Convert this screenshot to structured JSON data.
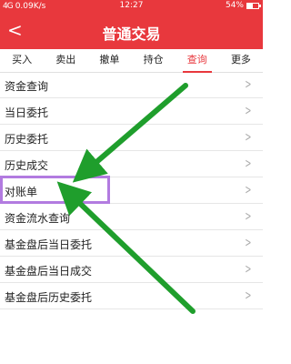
{
  "status": {
    "signal": "4G",
    "speed": "0.09K/s",
    "time": "12:27",
    "battery": "54%",
    "battery_fraction": 0.54
  },
  "header": {
    "back_symbol": "<",
    "title": "普通交易"
  },
  "tabs": [
    {
      "label": "买入"
    },
    {
      "label": "卖出"
    },
    {
      "label": "撤单"
    },
    {
      "label": "持仓"
    },
    {
      "label": "查询"
    },
    {
      "label": "更多"
    }
  ],
  "active_tab": "查询",
  "menu": [
    {
      "label": "资金查询"
    },
    {
      "label": "当日委托"
    },
    {
      "label": "历史委托"
    },
    {
      "label": "历史成交"
    },
    {
      "label": "对账单"
    },
    {
      "label": "资金流水查询"
    },
    {
      "label": "基金盘后当日委托"
    },
    {
      "label": "基金盘后当日成交"
    },
    {
      "label": "基金盘后历史委托"
    }
  ],
  "colors": {
    "brand": "#e8383d",
    "highlight": "#b27be0",
    "arrow": "#1f9e2c"
  }
}
